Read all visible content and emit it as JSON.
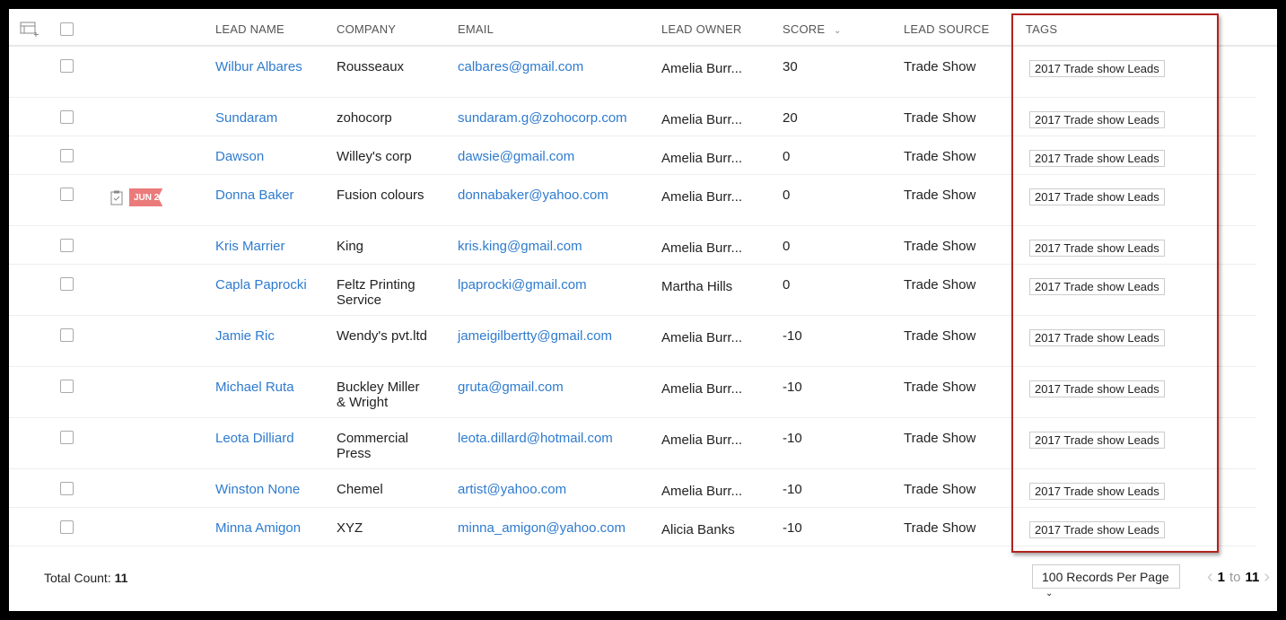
{
  "header": {
    "columns": [
      "LEAD NAME",
      "COMPANY",
      "EMAIL",
      "LEAD OWNER",
      "SCORE",
      "LEAD SOURCE",
      "TAGS"
    ],
    "score_sort_icon": "chevron-down-icon"
  },
  "rows": [
    {
      "name": "Wilbur Albares",
      "company": "Rousseaux",
      "email": "calbares@gmail.com",
      "owner": "Amelia Burr...",
      "score": "30",
      "source": "Trade Show",
      "tag": "2017 Trade show Leads",
      "h": 57
    },
    {
      "name": "Sundaram",
      "company": "zohocorp",
      "email": "sundaram.g@zohocorp.com",
      "owner": "Amelia Burr...",
      "score": "20",
      "source": "Trade Show",
      "tag": "2017 Trade show Leads",
      "h": 43
    },
    {
      "name": "Dawson",
      "company": "Willey's corp",
      "email": "dawsie@gmail.com",
      "owner": "Amelia Burr...",
      "score": "0",
      "source": "Trade Show",
      "tag": "2017 Trade show Leads",
      "h": 43
    },
    {
      "name": "Donna Baker",
      "company": "Fusion colours",
      "email": "donnabaker@yahoo.com",
      "owner": "Amelia Burr...",
      "score": "0",
      "source": "Trade Show",
      "tag": "2017 Trade show Leads",
      "flag": "JUN 2",
      "h": 57
    },
    {
      "name": "Kris Marrier",
      "company": "King",
      "email": "kris.king@gmail.com",
      "owner": "Amelia Burr...",
      "score": "0",
      "source": "Trade Show",
      "tag": "2017 Trade show Leads",
      "h": 43
    },
    {
      "name": "Capla Paprocki",
      "company": "Feltz Printing Service",
      "email": "lpaprocki@gmail.com",
      "owner": "Martha Hills",
      "score": "0",
      "source": "Trade Show",
      "tag": "2017 Trade show Leads",
      "h": 57
    },
    {
      "name": "Jamie Ric",
      "company": "Wendy's pvt.ltd",
      "email": "jameigilbertty@gmail.com",
      "owner": "Amelia Burr...",
      "score": "-10",
      "source": "Trade Show",
      "tag": "2017 Trade show Leads",
      "h": 57
    },
    {
      "name": "Michael Ruta",
      "company": "Buckley Miller & Wright",
      "email": "gruta@gmail.com",
      "owner": "Amelia Burr...",
      "score": "-10",
      "source": "Trade Show",
      "tag": "2017 Trade show Leads",
      "h": 57
    },
    {
      "name": "Leota Dilliard",
      "company": "Commercial Press",
      "email": "leota.dillard@hotmail.com",
      "owner": "Amelia Burr...",
      "score": "-10",
      "source": "Trade Show",
      "tag": "2017 Trade show Leads",
      "h": 57
    },
    {
      "name": "Winston None",
      "company": "Chemel",
      "email": "artist@yahoo.com",
      "owner": "Amelia Burr...",
      "score": "-10",
      "source": "Trade Show",
      "tag": "2017 Trade show Leads",
      "h": 43
    },
    {
      "name": "Minna Amigon",
      "company": "XYZ",
      "email": "minna_amigon@yahoo.com",
      "owner": "Alicia Banks",
      "score": "-10",
      "source": "Trade Show",
      "tag": "2017 Trade show Leads",
      "h": 43
    }
  ],
  "footer": {
    "total_label": "Total Count:",
    "total": "11",
    "per_page": "100 Records Per Page",
    "page_from": "1",
    "page_to_word": "to",
    "page_to": "11"
  },
  "colors": {
    "link": "#2e7bcf",
    "flag": "#eb7b7b",
    "highlight": "#b0231e"
  }
}
